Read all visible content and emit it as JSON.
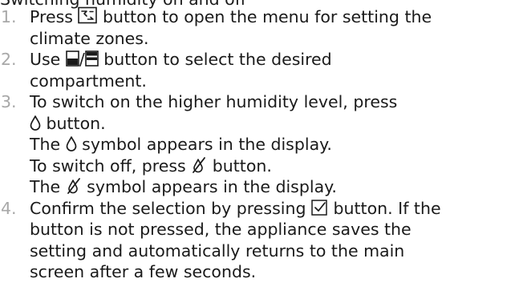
{
  "heading": "Switching humidity on and off",
  "steps": [
    {
      "number": "1.",
      "text_a": "Press ",
      "icon_a": "climate-zones-menu-icon",
      "text_b": " button to open the menu for setting the",
      "text_c": "climate zones."
    },
    {
      "number": "2.",
      "text_a": "Use ",
      "icon_a": "compartment-lower-icon",
      "sep": "/",
      "icon_b": "compartment-upper-icon",
      "text_b": " button to select the desired",
      "text_c": "compartment."
    },
    {
      "number": "3.",
      "text_a": "To switch on the higher humidity level, press",
      "icon_a": "humidity-drop-icon",
      "text_b": " button.",
      "text_c": "The ",
      "icon_b": "humidity-drop-icon",
      "text_d": " symbol appears in the display.",
      "text_e": "To switch off, press ",
      "icon_c": "humidity-off-icon",
      "text_f": " button.",
      "text_g": "The ",
      "icon_d": "humidity-off-icon",
      "text_h": " symbol appears in the display."
    },
    {
      "number": "4.",
      "text_a": "Confirm the selection by pressing ",
      "icon_a": "confirm-check-icon",
      "text_b": " button. If the",
      "text_c": "button is not pressed, the appliance saves the",
      "text_d": "setting and automatically returns to the main",
      "text_e": "screen after a few seconds."
    }
  ],
  "colors": {
    "text": "#1a1a1a",
    "step_number": "#a8a8a8"
  }
}
